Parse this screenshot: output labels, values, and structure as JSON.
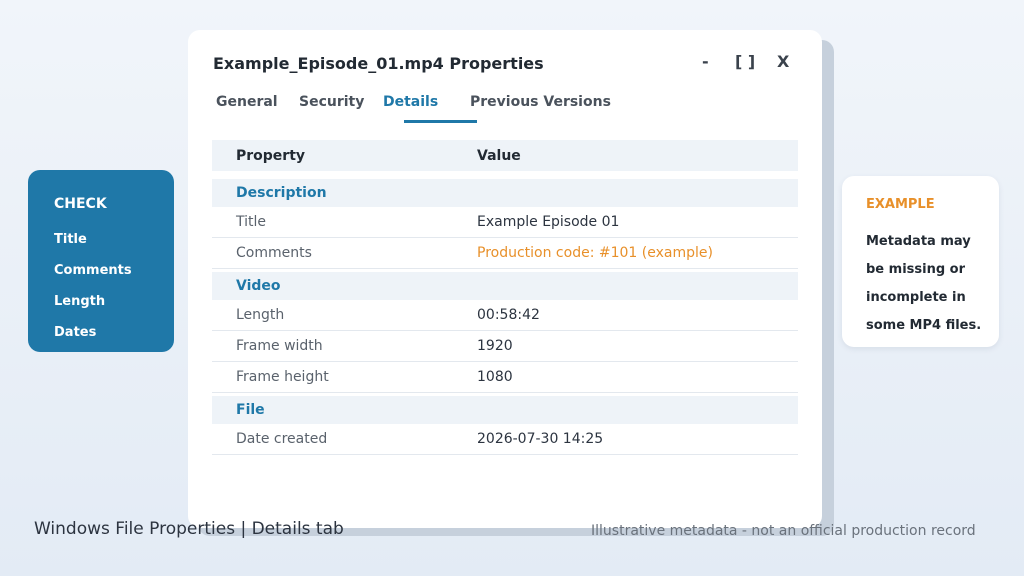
{
  "check_panel": {
    "title": "CHECK",
    "items": [
      "Title",
      "Comments",
      "Length",
      "Dates"
    ]
  },
  "example_panel": {
    "title": "EXAMPLE",
    "text": "Metadata may be missing or incomplete in some MP4 files."
  },
  "dialog": {
    "title": "Example_Episode_01.mp4 Properties",
    "controls": {
      "minimize": "-",
      "maximize": "[ ]",
      "close": "X"
    },
    "tabs": [
      {
        "label": "General"
      },
      {
        "label": "Security"
      },
      {
        "label": "Details",
        "active": true
      },
      {
        "label": "Previous Versions"
      }
    ],
    "table": {
      "headers": {
        "property": "Property",
        "value": "Value"
      },
      "sections": [
        {
          "name": "Description",
          "rows": [
            {
              "property": "Title",
              "value": "Example Episode 01"
            },
            {
              "property": "Comments",
              "value": "Production code: #101  (example)"
            }
          ]
        },
        {
          "name": "Video",
          "rows": [
            {
              "property": "Length",
              "value": "00:58:42"
            },
            {
              "property": "Frame width",
              "value": "1920"
            },
            {
              "property": "Frame height",
              "value": "1080"
            }
          ]
        },
        {
          "name": "File",
          "rows": [
            {
              "property": "Date created",
              "value": "2026-07-30  14:25"
            }
          ]
        }
      ]
    }
  },
  "footer": {
    "caption": "Windows File Properties  |  Details tab",
    "note": "Illustrative metadata - not an official production record"
  },
  "colors": {
    "accent_blue": "#1f78a8",
    "accent_orange": "#e8902a"
  }
}
